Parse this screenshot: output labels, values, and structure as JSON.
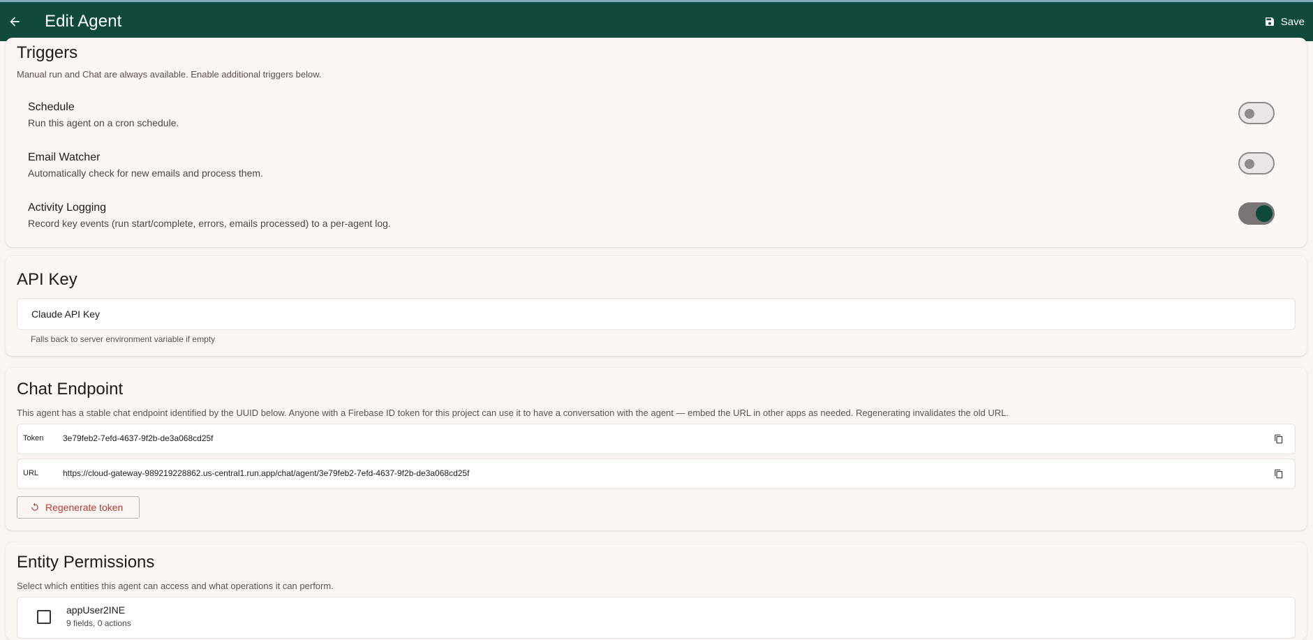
{
  "header": {
    "title": "Edit Agent",
    "save_label": "Save"
  },
  "colors": {
    "appbar": "#0f4a3c",
    "accent": "#0f4a3c",
    "danger": "#b43b32"
  },
  "triggers": {
    "heading": "Triggers",
    "description": "Manual run and Chat are always available. Enable additional triggers below.",
    "items": [
      {
        "title": "Schedule",
        "subtitle": "Run this agent on a cron schedule.",
        "enabled": false
      },
      {
        "title": "Email Watcher",
        "subtitle": "Automatically check for new emails and process them.",
        "enabled": false
      },
      {
        "title": "Activity Logging",
        "subtitle": "Record key events (run start/complete, errors, emails processed) to a per-agent log.",
        "enabled": true
      }
    ]
  },
  "api_key": {
    "heading": "API Key",
    "field_label": "Claude API Key",
    "helper": "Falls back to server environment variable if empty"
  },
  "chat_endpoint": {
    "heading": "Chat Endpoint",
    "description": "This agent has a stable chat endpoint identified by the UUID below. Anyone with a Firebase ID token for this project can use it to have a conversation with the agent — embed the URL in other apps as needed. Regenerating invalidates the old URL.",
    "token_label": "Token",
    "token_value": "3e79feb2-7efd-4637-9f2b-de3a068cd25f",
    "url_label": "URL",
    "url_value": "https://cloud-gateway-989219228862.us-central1.run.app/chat/agent/3e79feb2-7efd-4637-9f2b-de3a068cd25f",
    "regenerate_label": "Regenerate token"
  },
  "entity_permissions": {
    "heading": "Entity Permissions",
    "description": "Select which entities this agent can access and what operations it can perform.",
    "items": [
      {
        "name": "appUser2INE",
        "meta": "9 fields, 0 actions",
        "checked": false
      }
    ]
  }
}
